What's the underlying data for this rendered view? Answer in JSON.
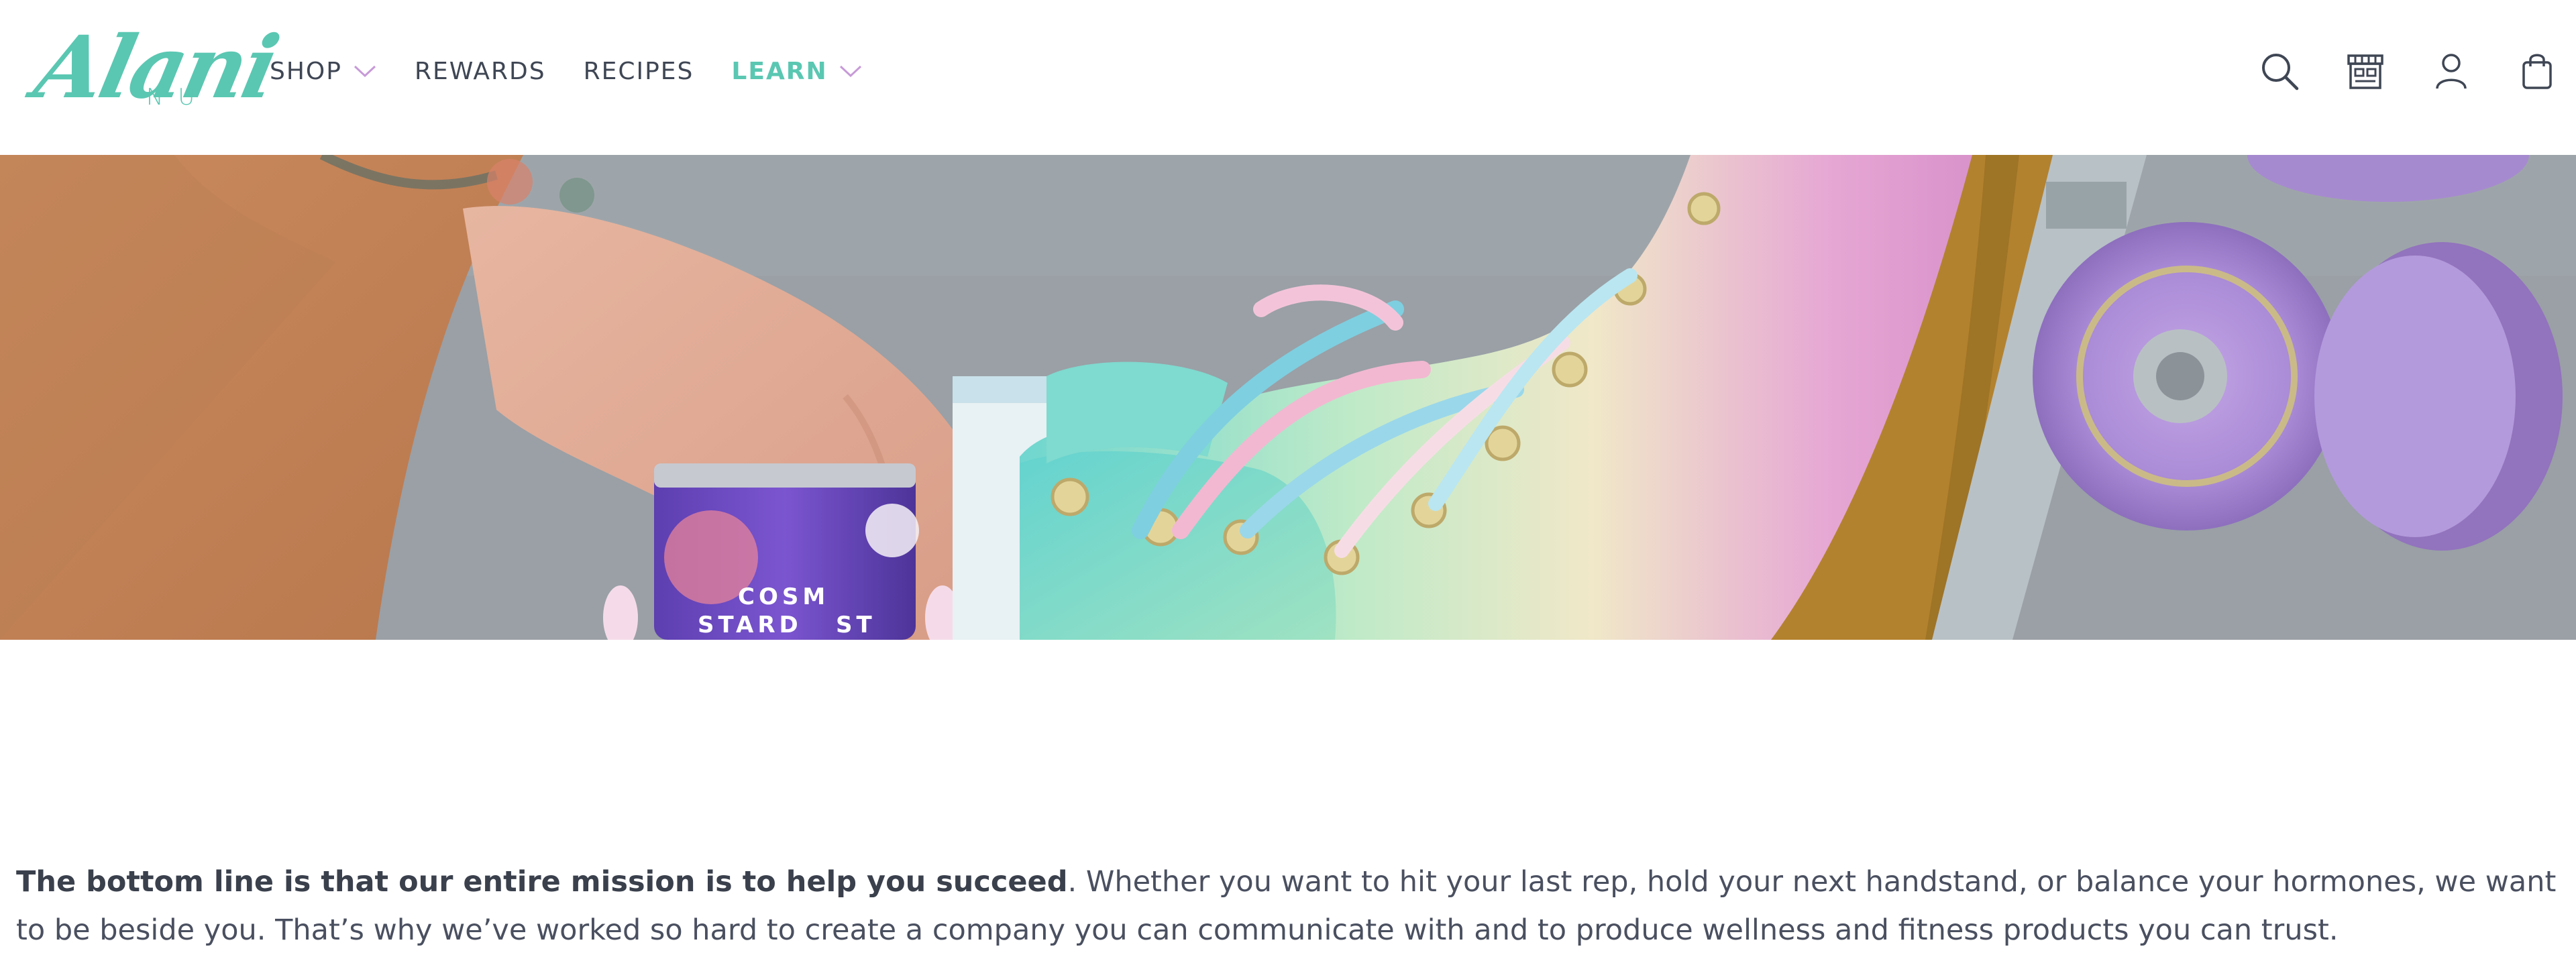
{
  "brand": {
    "logo_text": "Alani",
    "logo_subtext": "NU",
    "accent_color": "#5ac7b2",
    "chevron_color": "#c79ad8",
    "text_color": "#3f4654"
  },
  "nav": {
    "items": [
      {
        "label": "SHOP",
        "has_dropdown": true,
        "active": false
      },
      {
        "label": "REWARDS",
        "has_dropdown": false,
        "active": false
      },
      {
        "label": "RECIPES",
        "has_dropdown": false,
        "active": false
      },
      {
        "label": "LEARN",
        "has_dropdown": true,
        "active": true
      }
    ]
  },
  "header_icons": [
    "search-icon",
    "store-icon",
    "account-icon",
    "cart-bag-icon"
  ],
  "hero": {
    "alt_subject": "roller-skate-and-can-image",
    "can_text_line1": "COSM",
    "can_text_line2": "STARD",
    "can_text_line2b": "ST"
  },
  "article": {
    "bold_lead": "The bottom line is that our entire mission is to help you succeed",
    "rest": ". Whether you want to hit your last rep, hold your next handstand, or balance your hormones, we want to be beside you. That’s why we’ve worked so hard to create a company you can communicate with and to produce wellness and fitness products you can trust."
  }
}
